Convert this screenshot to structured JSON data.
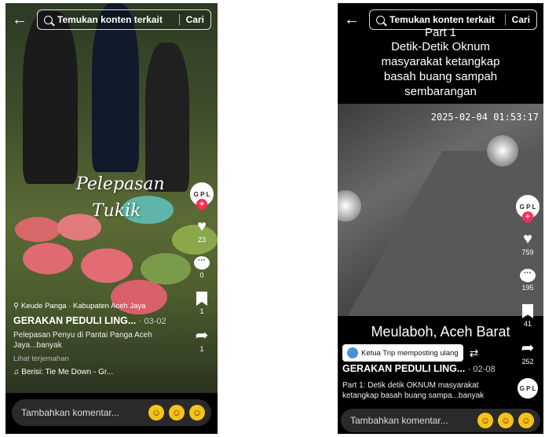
{
  "left": {
    "search": {
      "placeholder": "Temukan konten terkait",
      "button": "Cari"
    },
    "overlay_line1": "Pelepasan",
    "overlay_line2": "Tukik",
    "avatar_text": "G P L",
    "likes": "23",
    "comments": "0",
    "saves": "1",
    "shares": "1",
    "location": "Keude Panga · Kabupaten Aceh Jaya",
    "author": "GERAKAN PEDULI LING...",
    "date": "· 03-02",
    "description": "Pelepasan Penyu di Pantai Panga Aceh Jaya...banyak",
    "translate": "Lihat terjemahan",
    "music": "♫ Berisi: Tie Me Down - Gr...",
    "comment_placeholder": "Tambahkan komentar..."
  },
  "right": {
    "search": {
      "placeholder": "Temukan konten terkait",
      "button": "Cari"
    },
    "part_label": "Part 1",
    "headline": "Detik-Detik Oknum masyarakat ketangkap basah buang sampah sembarangan",
    "timestamp": "2025-02-04 01:53:17",
    "location_overlay": "Meulaboh, Aceh Barat",
    "avatar_text": "G P L",
    "likes": "759",
    "comments": "195",
    "saves": "41",
    "shares": "252",
    "repost_text": "Ketua Trip memposting ulang",
    "author": "GERAKAN PEDULI LING...",
    "date": "· 02-08",
    "description": "Part 1: Detik detik OKNUM masyarakat ketangkap basah buang sampa...banyak",
    "comment_placeholder": "Tambahkan komentar..."
  },
  "colors": {
    "accent": "#fe2c55",
    "emoji": "#f6c21c"
  }
}
